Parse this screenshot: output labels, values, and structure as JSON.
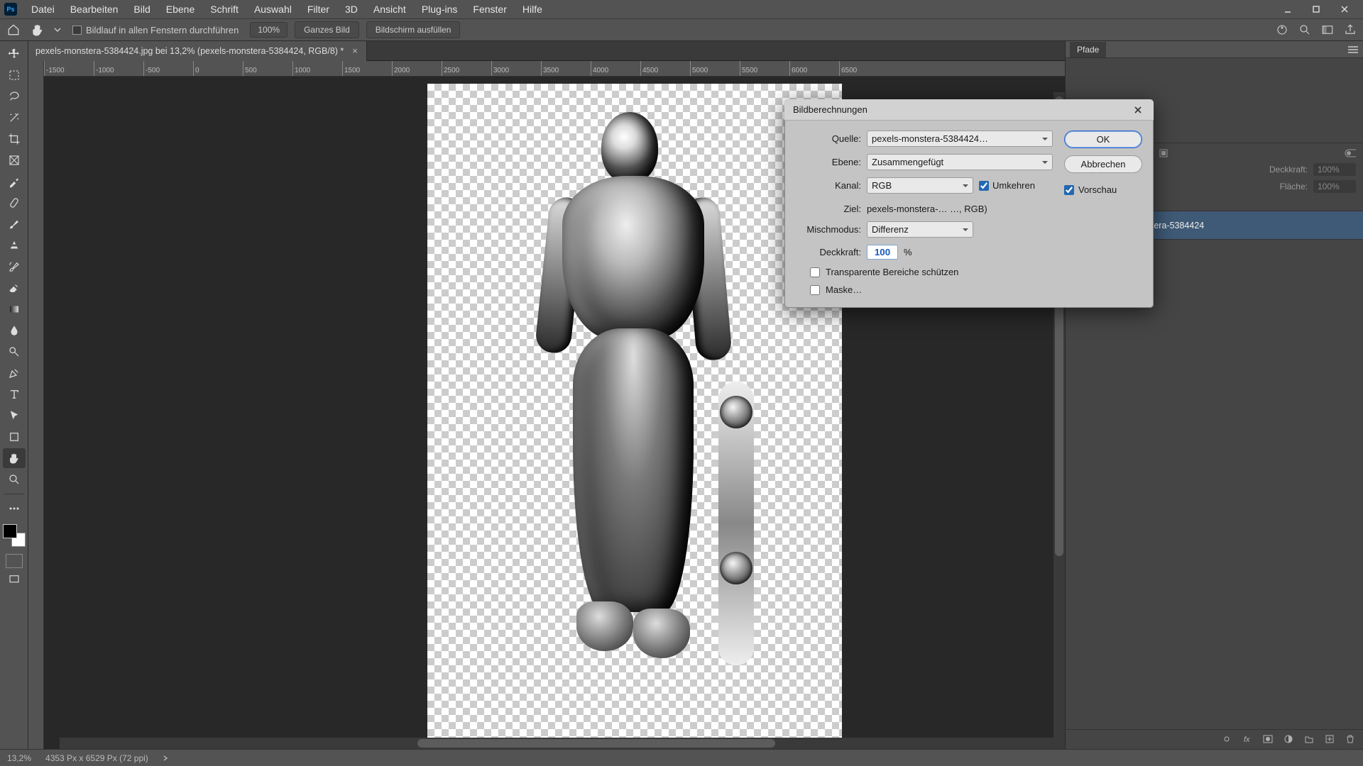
{
  "app": {
    "logo_text": "Ps"
  },
  "menu": {
    "items": [
      "Datei",
      "Bearbeiten",
      "Bild",
      "Ebene",
      "Schrift",
      "Auswahl",
      "Filter",
      "3D",
      "Ansicht",
      "Plug-ins",
      "Fenster",
      "Hilfe"
    ]
  },
  "options_bar": {
    "scroll_all_label": "Bildlauf in allen Fenstern durchführen",
    "zoom_pct": "100%",
    "full_image_btn": "Ganzes Bild",
    "fill_screen_btn": "Bildschirm ausfüllen"
  },
  "document": {
    "tab_title": "pexels-monstera-5384424.jpg bei 13,2% (pexels-monstera-5384424, RGB/8) *"
  },
  "ruler_h": {
    "ticks": [
      "-1500",
      "-1000",
      "-500",
      "0",
      "500",
      "1000",
      "1500",
      "2000",
      "2500",
      "3000",
      "3500",
      "4000",
      "4500",
      "5000",
      "5500",
      "6000",
      "6500"
    ]
  },
  "right_panel": {
    "tab_label": "Pfade",
    "opacity_label": "Deckkraft:",
    "opacity_value": "100%",
    "fill_label": "Fläche:",
    "fill_value": "100%",
    "layer_name": "pexels-monstera-5384424"
  },
  "status": {
    "zoom": "13,2%",
    "doc_info": "4353 Px x 6529 Px (72 ppi)"
  },
  "dialog": {
    "title": "Bildberechnungen",
    "source_label": "Quelle:",
    "source_value": "pexels-monstera-5384424…",
    "layer_label": "Ebene:",
    "layer_value": "Zusammengefügt",
    "channel_label": "Kanal:",
    "channel_value": "RGB",
    "invert_label": "Umkehren",
    "target_label": "Ziel:",
    "target_value": "pexels-monstera-… …, RGB)",
    "blend_label": "Mischmodus:",
    "blend_value": "Differenz",
    "opacity_label": "Deckkraft:",
    "opacity_value": "100",
    "opacity_pct": "%",
    "preserve_label": "Transparente Bereiche schützen",
    "mask_label": "Maske…",
    "ok": "OK",
    "cancel": "Abbrechen",
    "preview_label": "Vorschau"
  }
}
